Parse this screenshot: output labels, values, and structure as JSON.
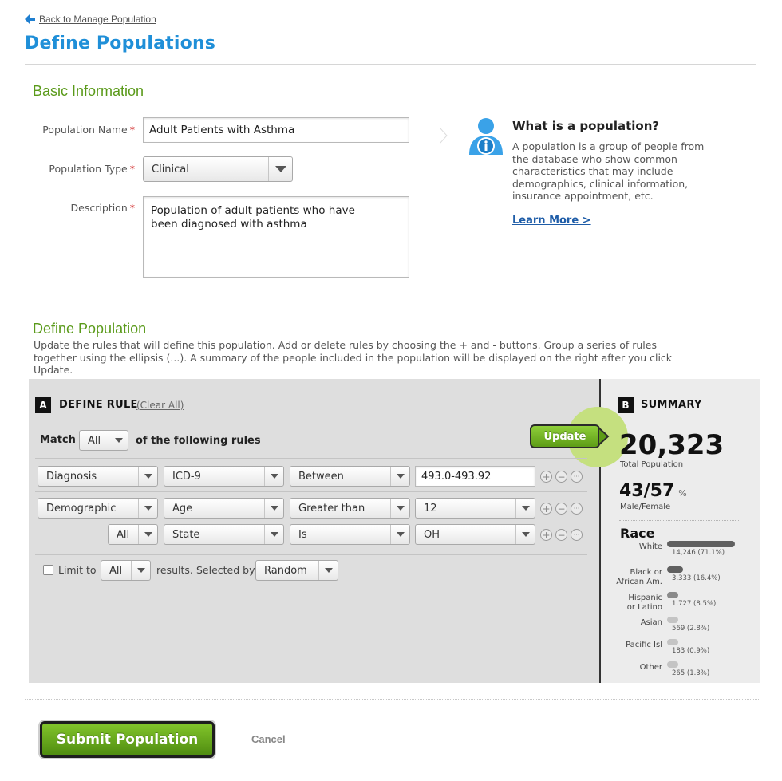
{
  "nav": {
    "back_label": "Back to Manage Population"
  },
  "page": {
    "title": "Define Populations"
  },
  "basic_info": {
    "title": "Basic Information",
    "name_label": "Population Name",
    "name_value": "Adult Patients with Asthma",
    "type_label": "Population Type",
    "type_value": "Clinical",
    "description_label": "Description",
    "description_value": "Population of adult patients who have\nbeen diagnosed with asthma",
    "required_mark": "*"
  },
  "info": {
    "heading": "What is a population?",
    "body": "A population is a group of people from the database who show common characteristics that may include demographics, clinical information, insurance appointment, etc.",
    "learn_more": "Learn More >"
  },
  "define_population": {
    "title": "Define Population",
    "instructions": "Update the rules that will define this population.  Add or delete rules by choosing the + and - buttons.  Group a series of rules together using the ellipsis (...).  A summary of the people included in the population will be displayed on the right after you click Update."
  },
  "rule_panel": {
    "letter": "A",
    "title": "DEFINE RULE",
    "clear_all": "(Clear All)",
    "match_label": "Match",
    "match_value": "All",
    "match_suffix": "of the following rules",
    "update_label": "Update",
    "rows": [
      {
        "category": "Diagnosis",
        "field": "ICD-9",
        "operator": "Between",
        "value": "493.0-493.92"
      },
      {
        "category": "Demographic",
        "field": "Age",
        "operator": "Greater than",
        "value": "12"
      },
      {
        "category": "All",
        "field": "State",
        "operator": "Is",
        "value": "OH"
      }
    ],
    "limit_label": "Limit to",
    "limit_value": "All",
    "results_label": "results.",
    "selected_by_label": "Selected by",
    "selected_by_value": "Random",
    "add_symbol": "+",
    "remove_symbol": "−",
    "group_symbol": "···"
  },
  "summary": {
    "letter": "B",
    "title": "SUMMARY",
    "total": "20,323",
    "total_caption": "Total Population",
    "ratio": "43/57",
    "ratio_unit": "%",
    "ratio_caption": "Male/Female",
    "race_title": "Race",
    "race": [
      {
        "label": "White",
        "value": "14,246 (71.1%)",
        "percent": 71.1,
        "color": "#606060"
      },
      {
        "label": "Black or\nAfrican Am.",
        "value": "3,333 (16.4%)",
        "percent": 16.4,
        "color": "#606060"
      },
      {
        "label": "Hispanic\nor Latino",
        "value": "1,727 (8.5%)",
        "percent": 8.5,
        "color": "#8a8a8a"
      },
      {
        "label": "Asian",
        "value": "569 (2.8%)",
        "percent": 2.8,
        "color": "#c4c4c4"
      },
      {
        "label": "Pacific Isl",
        "value": "183 (0.9%)",
        "percent": 0.9,
        "color": "#c4c4c4"
      },
      {
        "label": "Other",
        "value": "265 (1.3%)",
        "percent": 1.3,
        "color": "#c4c4c4"
      }
    ]
  },
  "footer": {
    "submit_label": "Submit Population",
    "cancel_label": "Cancel"
  },
  "colors": {
    "title_blue": "#1f8fd8",
    "section_green": "#5a9a1a",
    "button_green": "#6aab1f",
    "link_blue": "#1f5da8",
    "required_red": "#d01f1f"
  },
  "icons": [
    "back-arrow-icon",
    "person-info-icon",
    "chevron-down-icon",
    "plus-circle-icon",
    "minus-circle-icon",
    "ellipsis-circle-icon"
  ]
}
